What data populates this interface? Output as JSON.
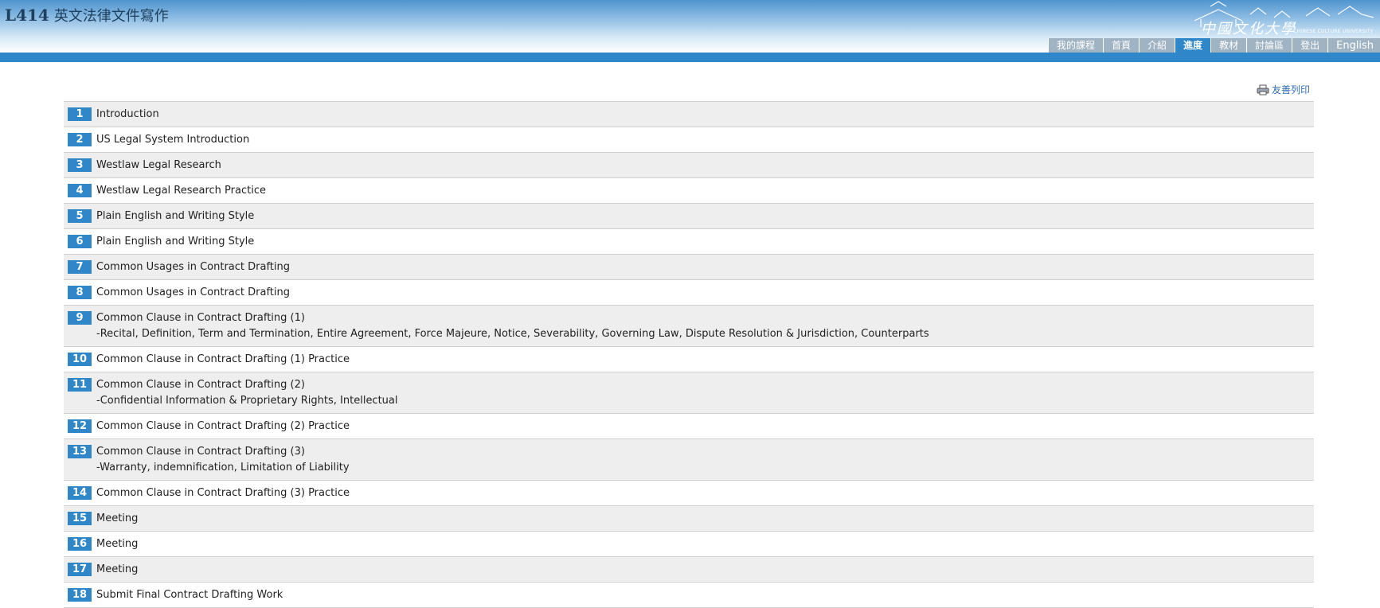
{
  "header": {
    "course_code": "L414",
    "course_name": "英文法律文件寫作",
    "logo_text": "中國文化大學",
    "logo_subtext": "CHINESE CULTURE UNIVERSITY"
  },
  "nav": {
    "items": [
      {
        "label": "我的課程"
      },
      {
        "label": "首頁"
      },
      {
        "label": "介紹"
      },
      {
        "label": "進度"
      },
      {
        "label": "教材"
      },
      {
        "label": "討論區"
      },
      {
        "label": "登出"
      },
      {
        "label": "English"
      }
    ],
    "active": "進度"
  },
  "print": {
    "label": "友善列印",
    "icon": "printer-icon"
  },
  "schedule": [
    {
      "number": "1",
      "title": "Introduction"
    },
    {
      "number": "2",
      "title": "US Legal System Introduction"
    },
    {
      "number": "3",
      "title": "Westlaw Legal Research"
    },
    {
      "number": "4",
      "title": "Westlaw Legal Research Practice"
    },
    {
      "number": "5",
      "title": "Plain English and Writing Style"
    },
    {
      "number": "6",
      "title": "Plain English and Writing Style"
    },
    {
      "number": "7",
      "title": "Common Usages in Contract Drafting"
    },
    {
      "number": "8",
      "title": "Common Usages in Contract Drafting"
    },
    {
      "number": "9",
      "title": "Common Clause in Contract Drafting (1)",
      "detail": "-Recital, Definition, Term and Termination, Entire Agreement, Force Majeure, Notice, Severability, Governing Law, Dispute Resolution & Jurisdiction, Counterparts"
    },
    {
      "number": "10",
      "title": "Common Clause in Contract Drafting (1) Practice"
    },
    {
      "number": "11",
      "title": "Common Clause in Contract Drafting (2)",
      "detail": "-Confidential Information & Proprietary Rights, Intellectual"
    },
    {
      "number": "12",
      "title": "Common Clause in Contract Drafting (2) Practice"
    },
    {
      "number": "13",
      "title": "Common Clause in Contract Drafting (3)",
      "detail": "-Warranty, indemnification, Limitation of Liability"
    },
    {
      "number": "14",
      "title": "Common Clause in Contract Drafting (3) Practice"
    },
    {
      "number": "15",
      "title": "Meeting"
    },
    {
      "number": "16",
      "title": "Meeting"
    },
    {
      "number": "17",
      "title": "Meeting"
    },
    {
      "number": "18",
      "title": "Submit Final Contract Drafting Work"
    }
  ],
  "colors": {
    "accent": "#2f86c9",
    "nav_inactive": "#9fb3c3",
    "row_alt": "#eeeeee",
    "link": "#2f6db0"
  }
}
